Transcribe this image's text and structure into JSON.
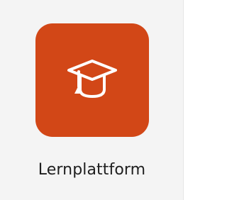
{
  "app": {
    "label": "Lernplattform",
    "icon": "graduation-cap-icon",
    "tile_color": "#d24717",
    "icon_color": "#ffffff",
    "background_color": "#f4f4f4"
  }
}
